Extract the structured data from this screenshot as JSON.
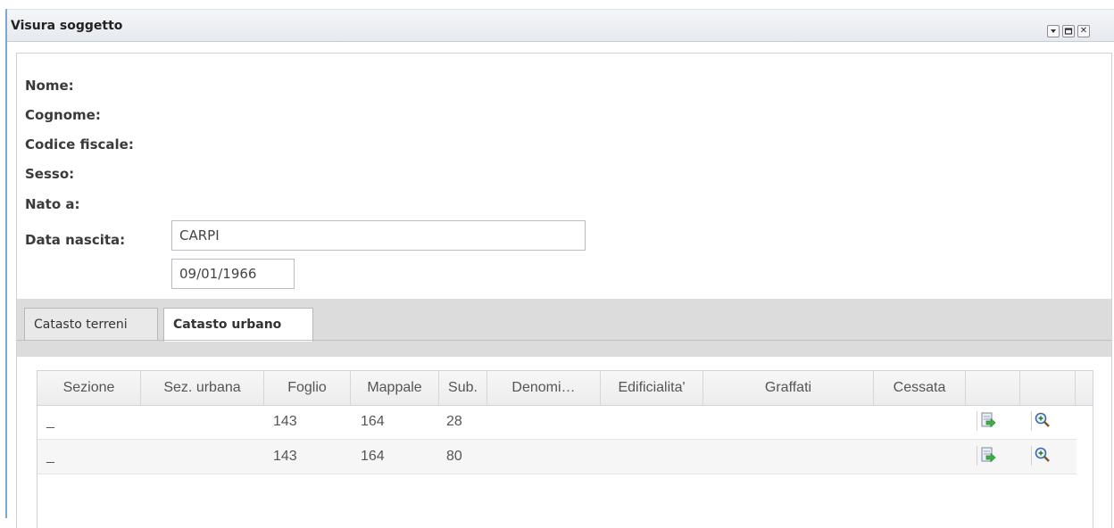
{
  "window": {
    "title": "Visura soggetto"
  },
  "tools": {
    "collapse_icon": "chevron-down-icon",
    "maximize_icon": "maximize-icon",
    "close_icon": "close-icon",
    "close_glyph": "✕"
  },
  "form": {
    "nome_label": "Nome:",
    "cognome_label": "Cognome:",
    "codice_fiscale_label": "Codice fiscale:",
    "sesso_label": "Sesso:",
    "nato_a_label": "Nato a:",
    "nato_a_value": "CARPI",
    "data_nascita_label": "Data nascita:",
    "data_nascita_value": "09/01/1966"
  },
  "tabs": [
    {
      "label": "Catasto terreni",
      "active": false
    },
    {
      "label": "Catasto urbano",
      "active": true
    }
  ],
  "grid": {
    "columns": [
      "Sezione",
      "Sez. urbana",
      "Foglio",
      "Mappale",
      "Sub.",
      "Denomi…",
      "Edificialita'",
      "Graffati",
      "Cessata"
    ],
    "rows": [
      {
        "sezione": "_",
        "foglio": "143",
        "mappale": "164",
        "sub": "28"
      },
      {
        "sezione": "_",
        "foglio": "143",
        "mappale": "164",
        "sub": "80"
      }
    ],
    "row_actions": [
      "export-document-icon",
      "zoom-in-icon"
    ]
  },
  "colors": {
    "accent_border": "#7ea7d9",
    "tab_strip": "#dcdcdc",
    "header_bg": "#eceff3"
  }
}
